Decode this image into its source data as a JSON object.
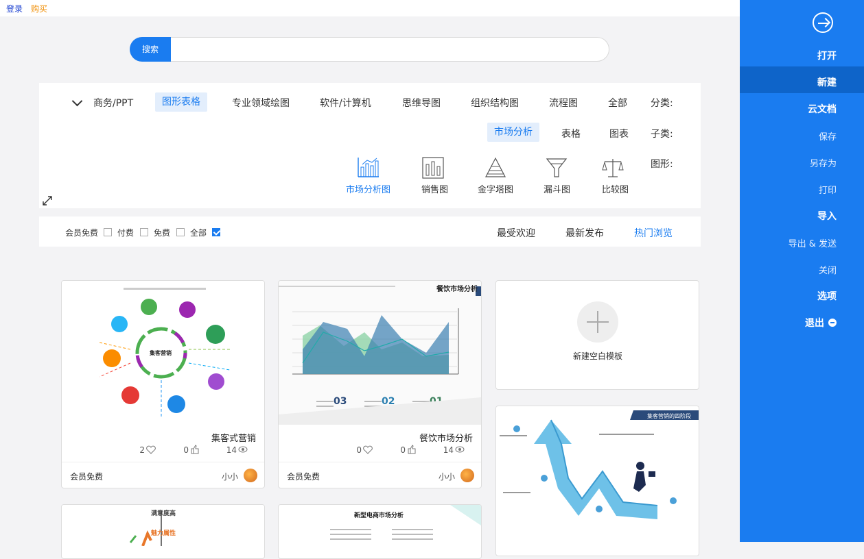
{
  "topbar": {
    "login": "登录",
    "buy": "购买"
  },
  "search": {
    "button": "搜索",
    "placeholder": "",
    "value": ""
  },
  "sidebar": {
    "items": [
      {
        "label": "打开"
      },
      {
        "label": "新建"
      },
      {
        "label": "云文档"
      },
      {
        "label": "保存"
      },
      {
        "label": "另存为"
      },
      {
        "label": "打印"
      },
      {
        "label": "导入"
      },
      {
        "label": "导出 & 发送"
      },
      {
        "label": "关闭"
      },
      {
        "label": "选项"
      },
      {
        "label": "退出"
      }
    ]
  },
  "filters": {
    "category_label": "分类:",
    "categories": [
      "全部",
      "流程图",
      "组织结构图",
      "思维导图",
      "软件/计算机",
      "专业领域绘图",
      "图形表格",
      "商务/PPT"
    ],
    "active_category": "图形表格",
    "subcategory_label": "子类:",
    "subcategories": [
      "图表",
      "表格",
      "市场分析"
    ],
    "active_subcategory": "市场分析",
    "shape_label": "图形:",
    "shapes": [
      {
        "label": "比较图",
        "icon": "scale-icon"
      },
      {
        "label": "漏斗图",
        "icon": "funnel-icon"
      },
      {
        "label": "金字塔图",
        "icon": "pyramid-icon"
      },
      {
        "label": "销售图",
        "icon": "bar-chart-icon"
      },
      {
        "label": "市场分析图",
        "icon": "market-chart-icon"
      }
    ],
    "active_shape": "市场分析图"
  },
  "sort": {
    "tabs": [
      "热门浏览",
      "最新发布",
      "最受欢迎"
    ],
    "active_tab": "热门浏览",
    "price_filters": [
      {
        "label": "全部",
        "checked": true
      },
      {
        "label": "免费",
        "checked": false
      },
      {
        "label": "付费",
        "checked": false
      },
      {
        "label": "会员免费",
        "checked": false
      }
    ]
  },
  "cards": {
    "new_blank": "新建空白模板",
    "items": [
      {
        "title": "餐饮市场分析",
        "views": "14",
        "likes": "0",
        "favorites": "0",
        "author": "小小",
        "price": "会员免费",
        "thumb_title": "餐饮市场分析",
        "sections": [
          "01",
          "02",
          "03"
        ]
      },
      {
        "title": "集客式营销",
        "views": "14",
        "likes": "0",
        "favorites": "2",
        "author": "小小",
        "price": "会员免费",
        "thumb_center": "集客营销"
      },
      {
        "title": "",
        "thumb_title": "集客营销的四阶段"
      },
      {
        "title": "",
        "thumb_title": "新型电商市场分析"
      },
      {
        "title": "",
        "thumb_title": "满意度高",
        "thumb_sub": "魅力属性"
      }
    ]
  },
  "colors": {
    "accent": "#1a7cf0",
    "sidebar_active": "#0e64c9",
    "buy": "#f08c00"
  }
}
